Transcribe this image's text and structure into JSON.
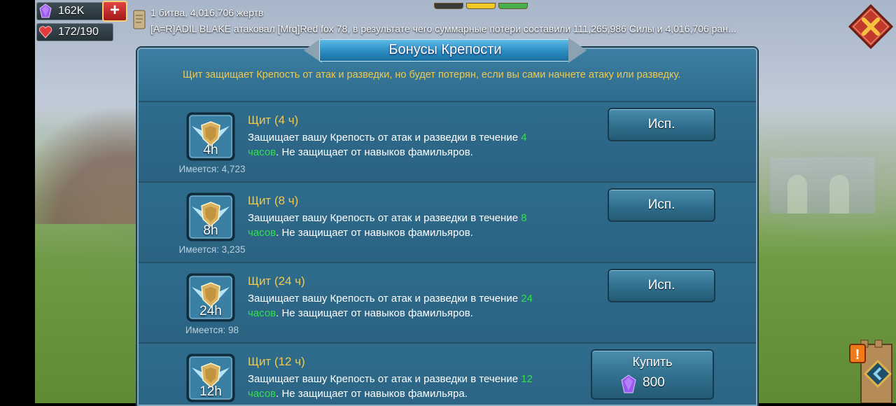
{
  "hud": {
    "gems": "162K",
    "plus_label": "+",
    "life": "172/190"
  },
  "ticker": {
    "line1": "1 битва, 4,016,706 жертв",
    "line2_attacker": "[A=R]ADIL BLAKE",
    "line2_verb": " атаковал ",
    "line2_target": "[Mrq]Red fox 78",
    "line2_rest": ", в результате чего суммарные потери составили ",
    "line2_power": "111,265,986",
    "line2_power_label": " Силы и ",
    "line2_kills": "4,016,706",
    "line2_tail": " ран..."
  },
  "panel": {
    "title": "Бонусы Крепости",
    "notice": "Щит защищает Крепость от атак и разведки, но будет потерян, если вы сами начнете атаку или разведку."
  },
  "items": [
    {
      "name": "Щит (4 ч)",
      "badge": "4h",
      "desc_a": "Защищает вашу Крепость от атак и разведки в течение ",
      "hours": "4",
      "desc_units": "часов",
      "desc_b": ". Не защищает от навыков фамильяров.",
      "owned": "Имеется: 4,723",
      "button": "Исп."
    },
    {
      "name": "Щит (8 ч)",
      "badge": "8h",
      "desc_a": "Защищает вашу Крепость от атак и разведки в течение ",
      "hours": "8",
      "desc_units": "часов",
      "desc_b": ". Не защищает от навыков фамильяров.",
      "owned": "Имеется: 3,235",
      "button": "Исп."
    },
    {
      "name": "Щит (24 ч)",
      "badge": "24h",
      "desc_a": "Защищает вашу Крепость от атак и разведки в течение ",
      "hours": "24",
      "desc_units": "часов",
      "desc_b": ". Не защищает от навыков фамильяров.",
      "owned": "Имеется: 98",
      "button": "Исп."
    },
    {
      "name": "Щит (12 ч)",
      "badge": "12h",
      "desc_a": "Защищает вашу Крепость от атак и разведки в течение ",
      "hours": "12",
      "desc_units": "часов",
      "desc_b": ". Не защищает от навыков фамильяра.",
      "buy_label": "Купить",
      "price": "800"
    }
  ],
  "colors": {
    "accent_gold": "#f1c94a",
    "highlight_green": "#33e04a",
    "panel_blue": "#2d6686",
    "gem_purple": "#8e44e8",
    "close_red": "#c0392b"
  },
  "icons": {
    "gem": "gem-icon",
    "life": "heart-icon",
    "close": "close-icon",
    "scroll": "scroll-icon",
    "shield": "shield-icon"
  }
}
